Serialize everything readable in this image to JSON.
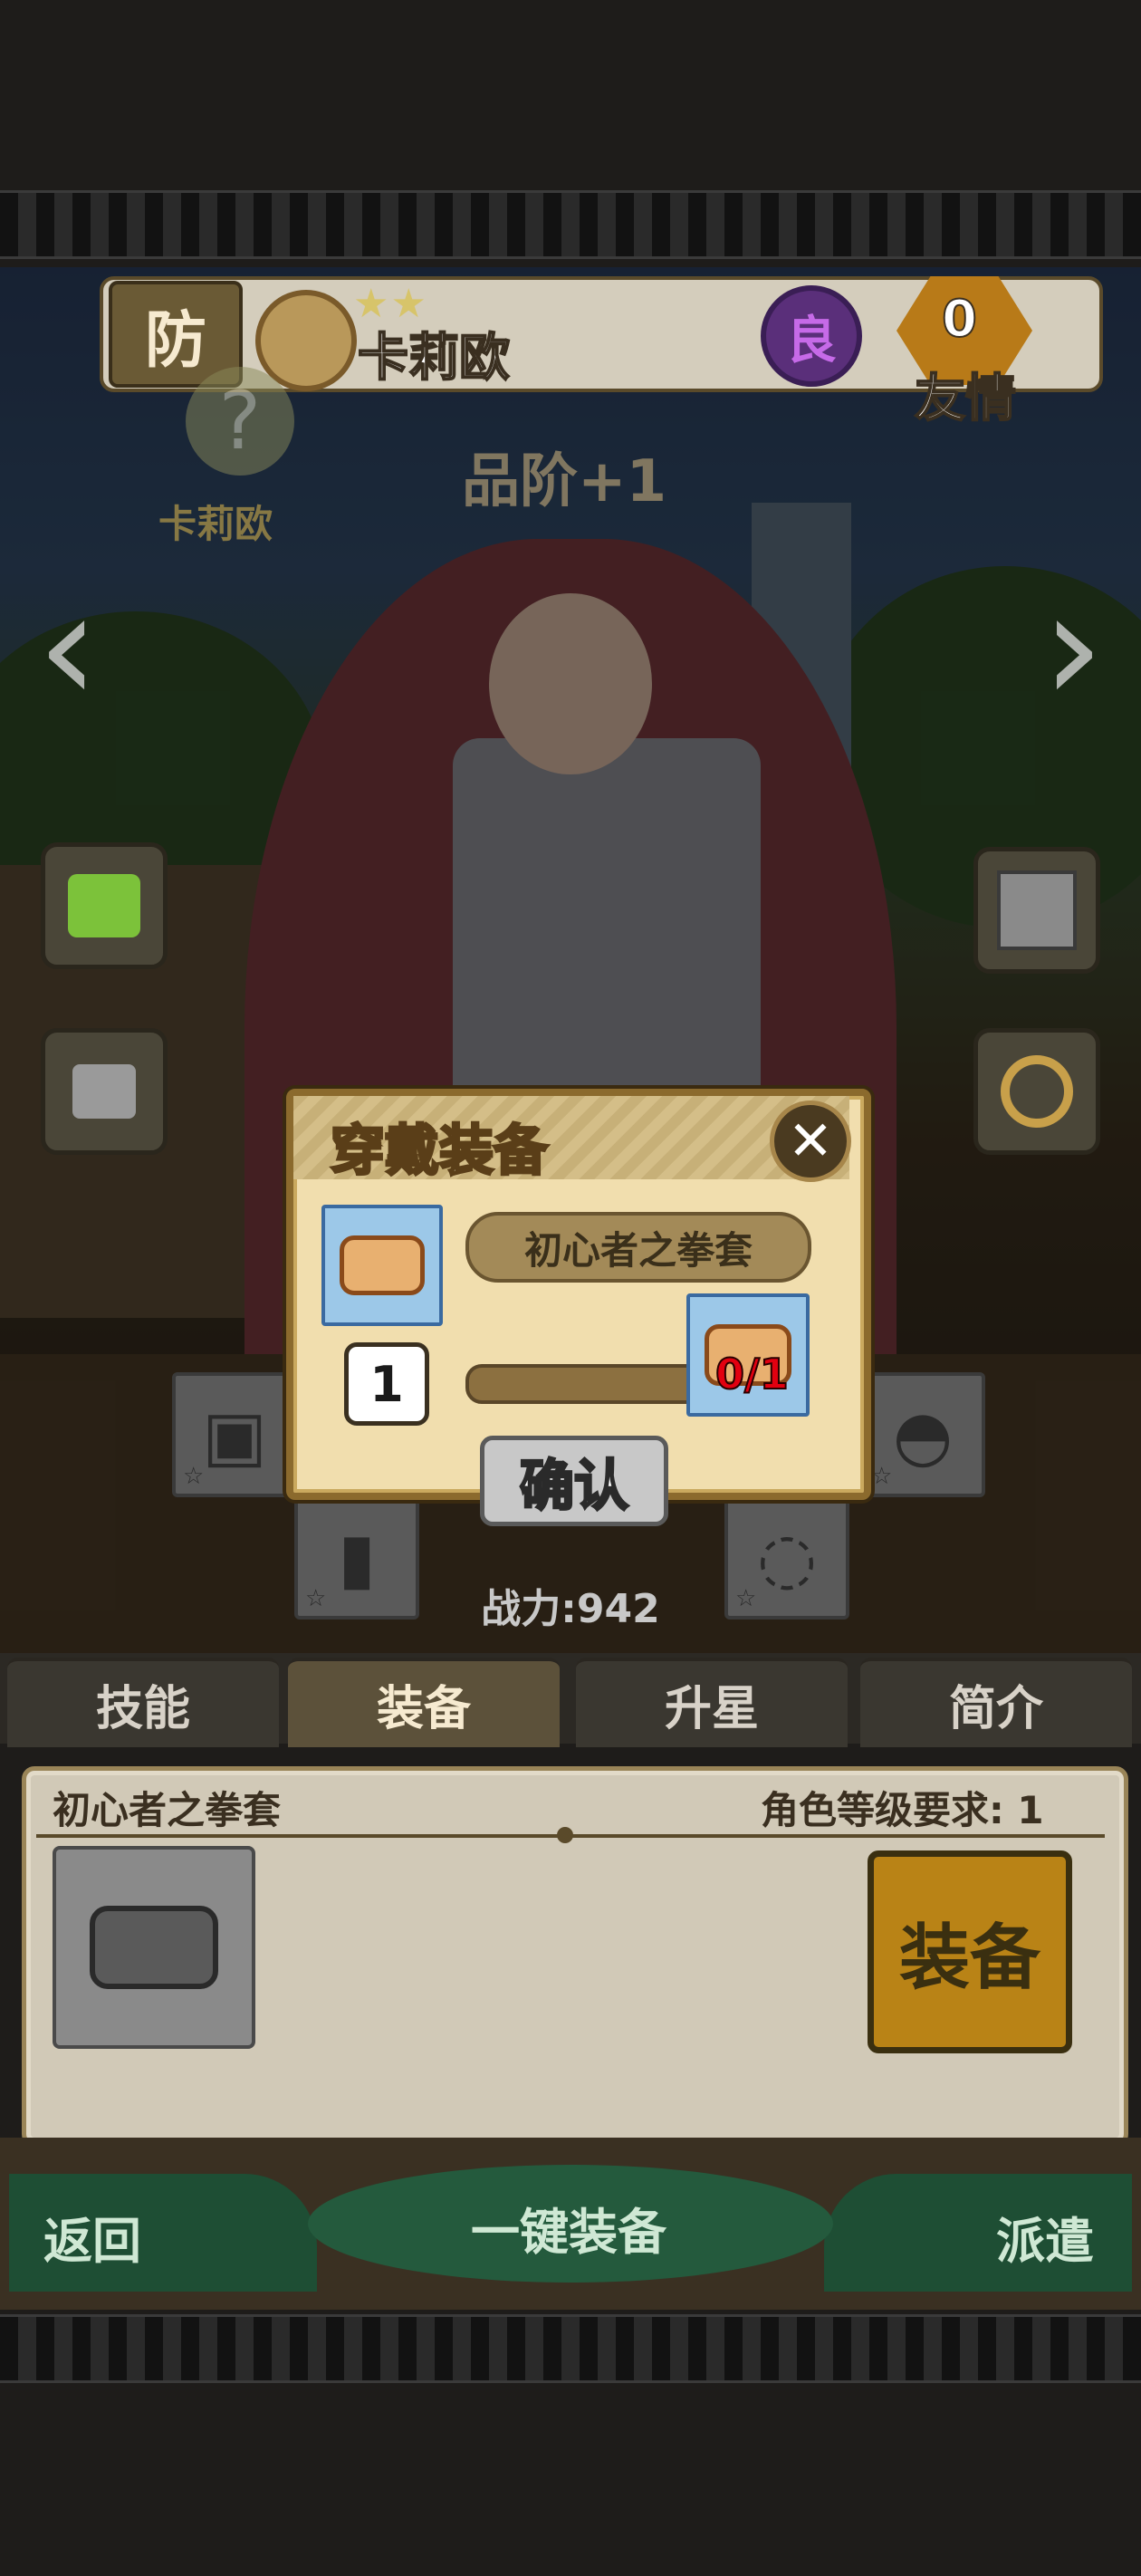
{
  "character": {
    "role_badge": "防",
    "stars": "★★",
    "name": "卡莉欧",
    "rarity": "良",
    "friendship_count": "0",
    "friendship_label": "友情",
    "quality_label": "品阶+1",
    "ghost_name": "卡莉欧",
    "power": "战力:942"
  },
  "nav": {
    "prev": "‹",
    "next": "›"
  },
  "modal": {
    "title": "穿戴装备",
    "item_name": "初心者之拳套",
    "required_count": "1",
    "progress_ratio": "0/1",
    "progress_fraction": 0,
    "confirm_label": "确认"
  },
  "tabs": [
    {
      "label": "技能"
    },
    {
      "label": "装备"
    },
    {
      "label": "升星"
    },
    {
      "label": "简介"
    }
  ],
  "equipment_panel": {
    "item_name": "初心者之拳套",
    "level_requirement": "角色等级要求: 1",
    "equip_button": "装备"
  },
  "bottom_bar": {
    "back": "返回",
    "one_click": "一键装备",
    "dispatch": "派遣"
  },
  "icons": {
    "close": "close-icon",
    "gift": "gift-icon",
    "search": "magnifier-icon",
    "lock": "lock-icon",
    "potion": "potion-icon"
  }
}
